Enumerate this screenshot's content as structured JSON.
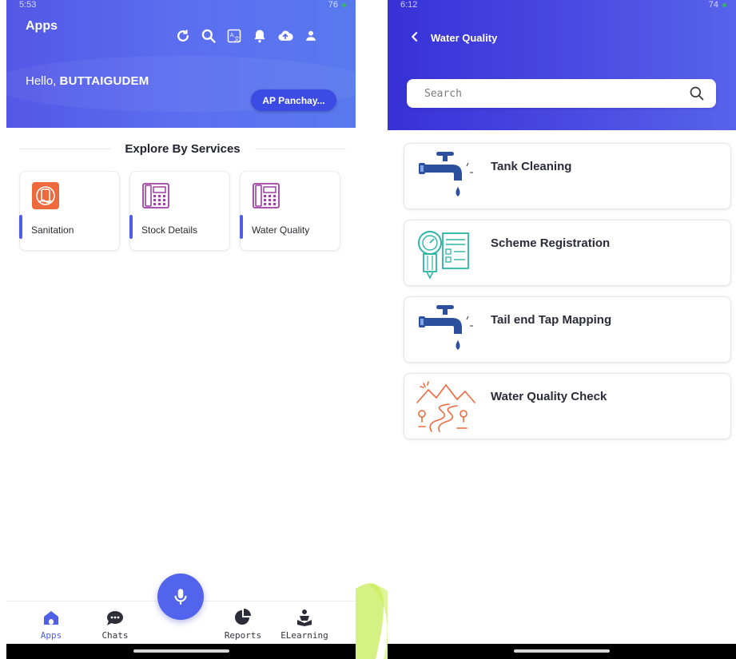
{
  "left_screen": {
    "status_bar": {
      "time": "5:53",
      "battery": "76"
    },
    "header": {
      "title": "Apps",
      "greeting_prefix": "Hello,",
      "user_name": "BUTTAIGUDEM",
      "panchayat_button": "AP Panchay..."
    },
    "section_heading": "Explore By Services",
    "services": [
      {
        "label": "Sanitation",
        "icon": "sanitation-icon"
      },
      {
        "label": "Stock Details",
        "icon": "office-phone-icon"
      },
      {
        "label": "Water Quality",
        "icon": "office-phone-icon"
      }
    ],
    "bottom_nav": [
      {
        "label": "Apps",
        "icon": "home-icon",
        "active": true
      },
      {
        "label": "Chats",
        "icon": "chat-icon",
        "active": false
      },
      {
        "label": "Reports",
        "icon": "pie-chart-icon",
        "active": false
      },
      {
        "label": "ELearning",
        "icon": "reader-icon",
        "active": false
      }
    ]
  },
  "right_screen": {
    "status_bar": {
      "time": "6:12",
      "battery": "74"
    },
    "header": {
      "title": "Water Quality"
    },
    "search": {
      "placeholder": "Search"
    },
    "items": [
      {
        "label": "Tank Cleaning",
        "icon": "water-tap-icon"
      },
      {
        "label": "Scheme Registration",
        "icon": "meter-checklist-icon"
      },
      {
        "label": "Tail end Tap Mapping",
        "icon": "water-tap-icon"
      },
      {
        "label": "Water Quality Check",
        "icon": "river-landscape-icon"
      }
    ]
  },
  "colors": {
    "header_blue": "#5763ec",
    "header_indigo": "#3731d6",
    "accent": "#4f5ee6",
    "orange_icon": "#ee6a3c",
    "teal_icon": "#2bb5a6",
    "tap_blue": "#2c4f9e",
    "watermark_green": "#b5e61d"
  }
}
